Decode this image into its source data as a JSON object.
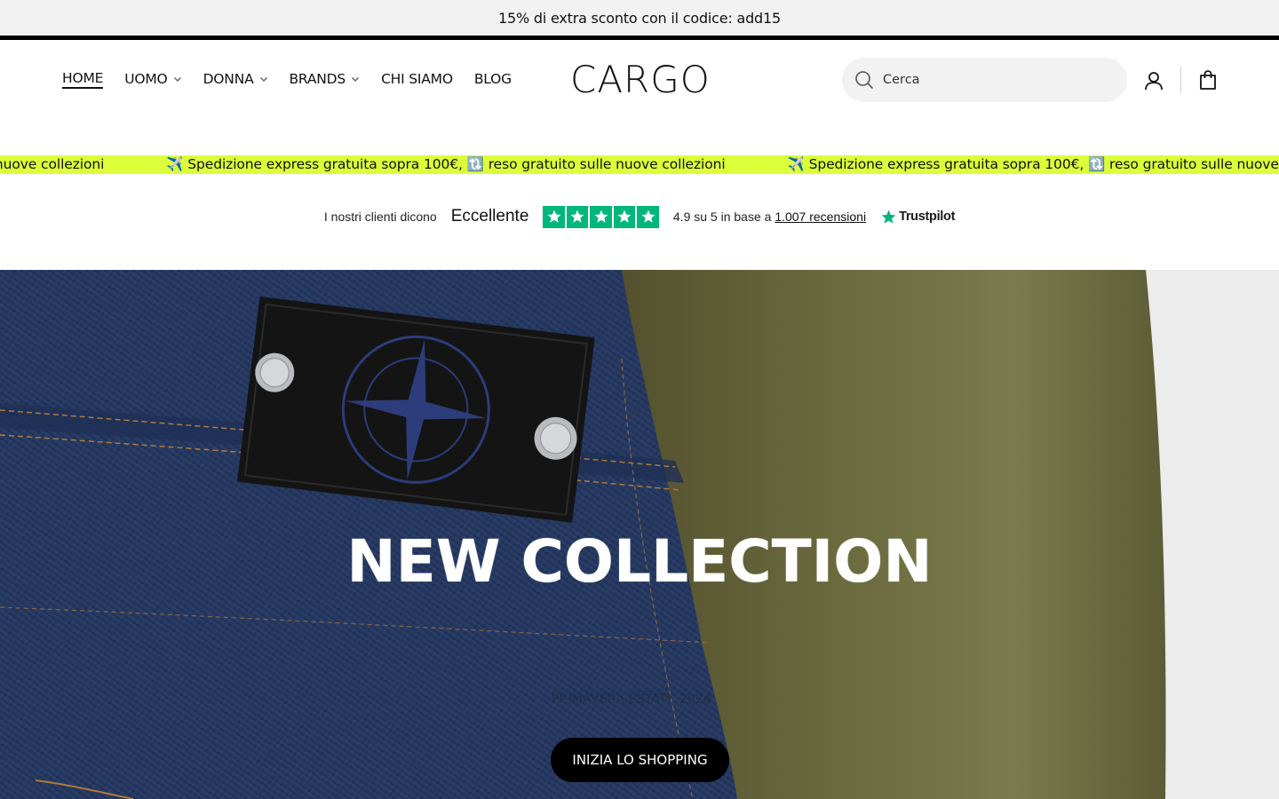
{
  "announcement": {
    "text": "15% di extra sconto con il codice: add15"
  },
  "nav": {
    "items": [
      {
        "label": "HOME"
      },
      {
        "label": "UOMO"
      },
      {
        "label": "DONNA"
      },
      {
        "label": "BRANDS"
      },
      {
        "label": "CHI SIAMO"
      },
      {
        "label": "BLOG"
      }
    ]
  },
  "brand": {
    "logo": "CARGO"
  },
  "search": {
    "placeholder": "Cerca"
  },
  "ticker": {
    "lead_fragment": "ratuita sopra 100€, 🔃 reso gratuito sulle nuove collezioni",
    "message": "✈️ Spedizione express gratuita sopra 100€, 🔃 reso gratuito sulle nuove collezioni",
    "tail_fragment": "✈️ Spedizione express gratu"
  },
  "trustpilot": {
    "intro": "I nostri clienti dicono",
    "rating_label": "Eccellente",
    "score_prefix": "4.9 su 5 in base a",
    "reviews_link": "1.007 recensioni",
    "logo_text": "Trustpilot",
    "star_color": "#00b67a"
  },
  "hero": {
    "title": "NEW COLLECTION",
    "subtitle": "PRIMAVERA ESTATE 2024",
    "cta": "INIZIA LO SHOPPING"
  },
  "colors": {
    "ticker_bg": "#dcff3a",
    "announcement_bg": "#f2f2f2"
  }
}
